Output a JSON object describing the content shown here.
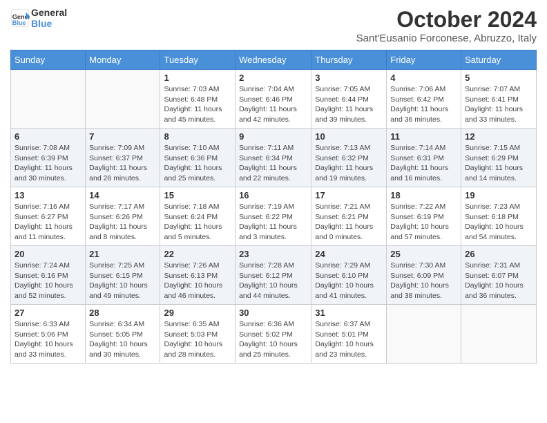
{
  "header": {
    "logo_line1": "General",
    "logo_line2": "Blue",
    "month": "October 2024",
    "location": "Sant'Eusanio Forconese, Abruzzo, Italy"
  },
  "weekdays": [
    "Sunday",
    "Monday",
    "Tuesday",
    "Wednesday",
    "Thursday",
    "Friday",
    "Saturday"
  ],
  "weeks": [
    [
      {
        "day": "",
        "info": ""
      },
      {
        "day": "",
        "info": ""
      },
      {
        "day": "1",
        "info": "Sunrise: 7:03 AM\nSunset: 6:48 PM\nDaylight: 11 hours and 45 minutes."
      },
      {
        "day": "2",
        "info": "Sunrise: 7:04 AM\nSunset: 6:46 PM\nDaylight: 11 hours and 42 minutes."
      },
      {
        "day": "3",
        "info": "Sunrise: 7:05 AM\nSunset: 6:44 PM\nDaylight: 11 hours and 39 minutes."
      },
      {
        "day": "4",
        "info": "Sunrise: 7:06 AM\nSunset: 6:42 PM\nDaylight: 11 hours and 36 minutes."
      },
      {
        "day": "5",
        "info": "Sunrise: 7:07 AM\nSunset: 6:41 PM\nDaylight: 11 hours and 33 minutes."
      }
    ],
    [
      {
        "day": "6",
        "info": "Sunrise: 7:08 AM\nSunset: 6:39 PM\nDaylight: 11 hours and 30 minutes."
      },
      {
        "day": "7",
        "info": "Sunrise: 7:09 AM\nSunset: 6:37 PM\nDaylight: 11 hours and 28 minutes."
      },
      {
        "day": "8",
        "info": "Sunrise: 7:10 AM\nSunset: 6:36 PM\nDaylight: 11 hours and 25 minutes."
      },
      {
        "day": "9",
        "info": "Sunrise: 7:11 AM\nSunset: 6:34 PM\nDaylight: 11 hours and 22 minutes."
      },
      {
        "day": "10",
        "info": "Sunrise: 7:13 AM\nSunset: 6:32 PM\nDaylight: 11 hours and 19 minutes."
      },
      {
        "day": "11",
        "info": "Sunrise: 7:14 AM\nSunset: 6:31 PM\nDaylight: 11 hours and 16 minutes."
      },
      {
        "day": "12",
        "info": "Sunrise: 7:15 AM\nSunset: 6:29 PM\nDaylight: 11 hours and 14 minutes."
      }
    ],
    [
      {
        "day": "13",
        "info": "Sunrise: 7:16 AM\nSunset: 6:27 PM\nDaylight: 11 hours and 11 minutes."
      },
      {
        "day": "14",
        "info": "Sunrise: 7:17 AM\nSunset: 6:26 PM\nDaylight: 11 hours and 8 minutes."
      },
      {
        "day": "15",
        "info": "Sunrise: 7:18 AM\nSunset: 6:24 PM\nDaylight: 11 hours and 5 minutes."
      },
      {
        "day": "16",
        "info": "Sunrise: 7:19 AM\nSunset: 6:22 PM\nDaylight: 11 hours and 3 minutes."
      },
      {
        "day": "17",
        "info": "Sunrise: 7:21 AM\nSunset: 6:21 PM\nDaylight: 11 hours and 0 minutes."
      },
      {
        "day": "18",
        "info": "Sunrise: 7:22 AM\nSunset: 6:19 PM\nDaylight: 10 hours and 57 minutes."
      },
      {
        "day": "19",
        "info": "Sunrise: 7:23 AM\nSunset: 6:18 PM\nDaylight: 10 hours and 54 minutes."
      }
    ],
    [
      {
        "day": "20",
        "info": "Sunrise: 7:24 AM\nSunset: 6:16 PM\nDaylight: 10 hours and 52 minutes."
      },
      {
        "day": "21",
        "info": "Sunrise: 7:25 AM\nSunset: 6:15 PM\nDaylight: 10 hours and 49 minutes."
      },
      {
        "day": "22",
        "info": "Sunrise: 7:26 AM\nSunset: 6:13 PM\nDaylight: 10 hours and 46 minutes."
      },
      {
        "day": "23",
        "info": "Sunrise: 7:28 AM\nSunset: 6:12 PM\nDaylight: 10 hours and 44 minutes."
      },
      {
        "day": "24",
        "info": "Sunrise: 7:29 AM\nSunset: 6:10 PM\nDaylight: 10 hours and 41 minutes."
      },
      {
        "day": "25",
        "info": "Sunrise: 7:30 AM\nSunset: 6:09 PM\nDaylight: 10 hours and 38 minutes."
      },
      {
        "day": "26",
        "info": "Sunrise: 7:31 AM\nSunset: 6:07 PM\nDaylight: 10 hours and 36 minutes."
      }
    ],
    [
      {
        "day": "27",
        "info": "Sunrise: 6:33 AM\nSunset: 5:06 PM\nDaylight: 10 hours and 33 minutes."
      },
      {
        "day": "28",
        "info": "Sunrise: 6:34 AM\nSunset: 5:05 PM\nDaylight: 10 hours and 30 minutes."
      },
      {
        "day": "29",
        "info": "Sunrise: 6:35 AM\nSunset: 5:03 PM\nDaylight: 10 hours and 28 minutes."
      },
      {
        "day": "30",
        "info": "Sunrise: 6:36 AM\nSunset: 5:02 PM\nDaylight: 10 hours and 25 minutes."
      },
      {
        "day": "31",
        "info": "Sunrise: 6:37 AM\nSunset: 5:01 PM\nDaylight: 10 hours and 23 minutes."
      },
      {
        "day": "",
        "info": ""
      },
      {
        "day": "",
        "info": ""
      }
    ]
  ]
}
